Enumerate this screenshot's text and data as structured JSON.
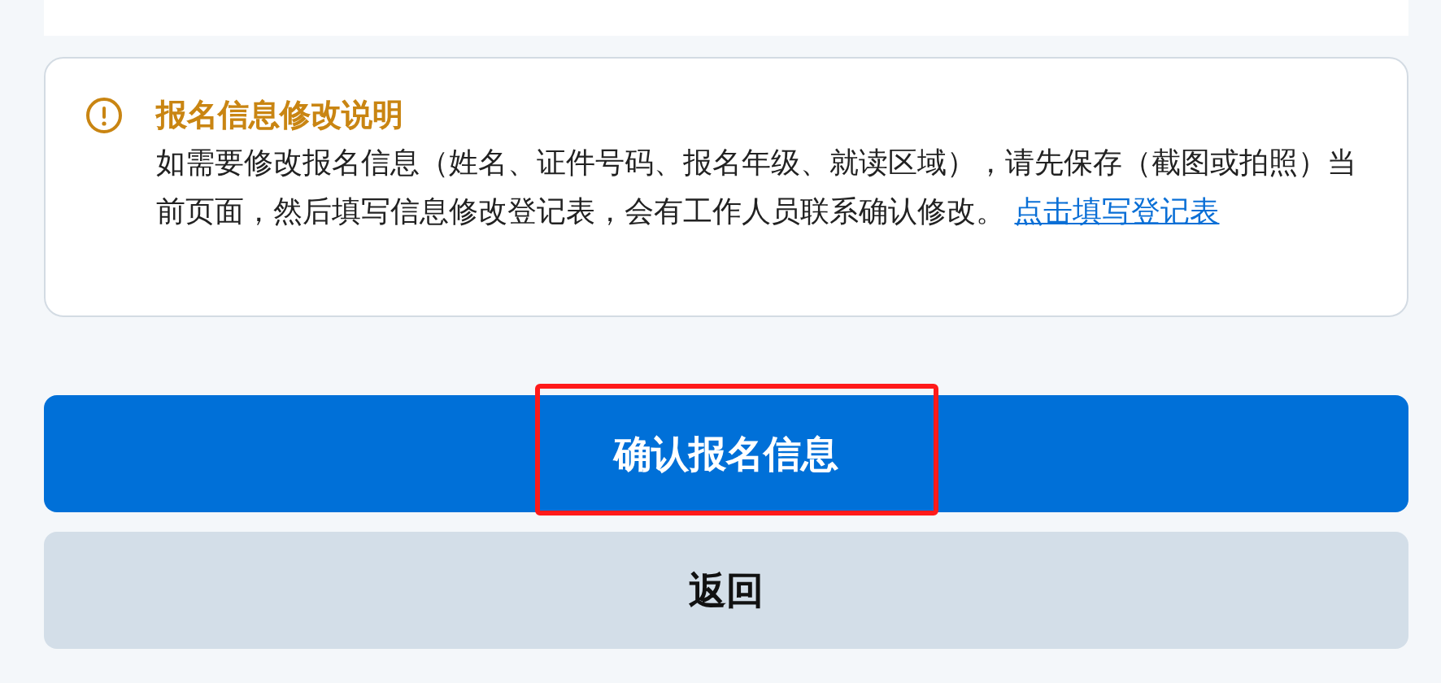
{
  "notice": {
    "title": "报名信息修改说明",
    "text": "如需要修改报名信息（姓名、证件号码、报名年级、就读区域），请先保存（截图或拍照）当前页面，然后填写信息修改登记表，会有工作人员联系确认修改。",
    "link": "点击填写登记表"
  },
  "buttons": [
    {
      "kind": "primary",
      "label": "确认报名信息",
      "highlighted": true
    },
    {
      "kind": "secondary",
      "label": "返回",
      "highlighted": false
    }
  ]
}
